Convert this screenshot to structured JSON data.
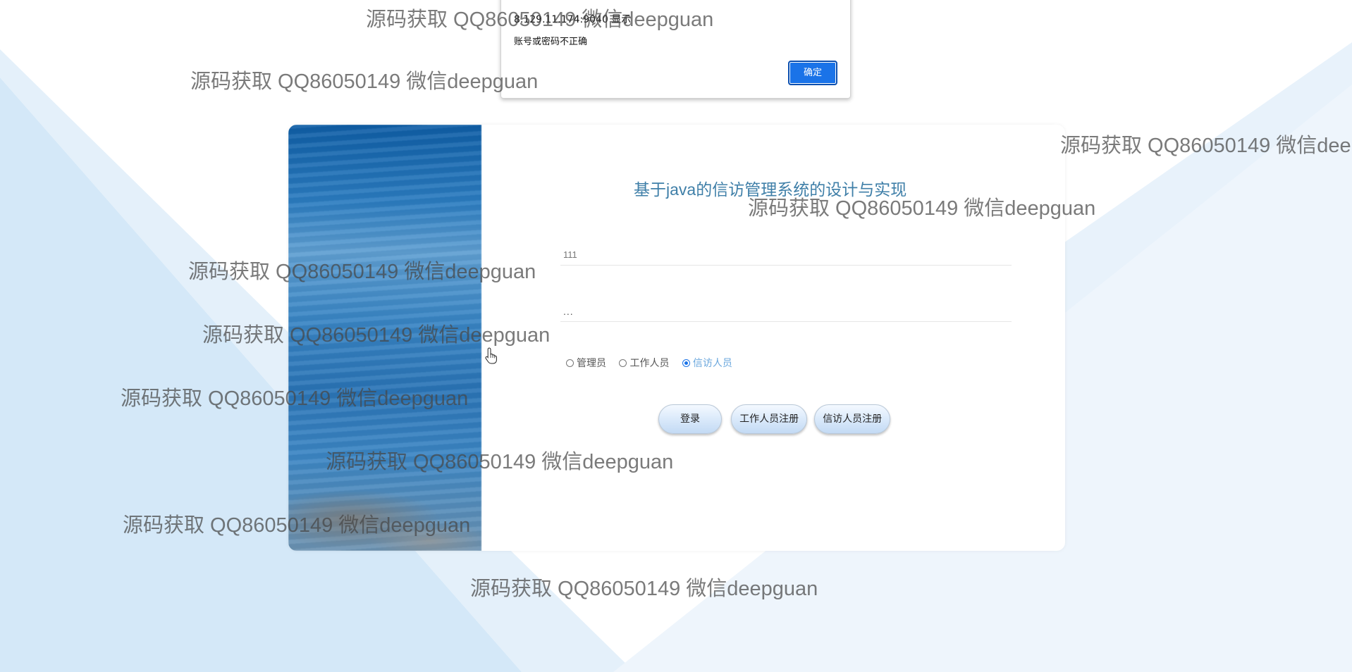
{
  "colors": {
    "accent": "#1a73e8",
    "title": "#3f7fa8",
    "background_band": "#d6e9f8"
  },
  "alert": {
    "title": "8.129.11.174:9040 显示",
    "message": "账号或密码不正确",
    "ok_label": "确定"
  },
  "login": {
    "title": "基于java的信访管理系统的设计与实现",
    "username_value": "111",
    "password_value": "...",
    "roles": [
      {
        "label": "管理员",
        "selected": false
      },
      {
        "label": "工作人员",
        "selected": false
      },
      {
        "label": "信访人员",
        "selected": true
      }
    ],
    "buttons": {
      "login": "登录",
      "staff_register": "工作人员注册",
      "petitioner_register": "信访人员注册"
    }
  },
  "watermark_text": "源码获取 QQ86050149 微信deepguan",
  "icons": {
    "cursor": "hand-pointer-icon"
  }
}
